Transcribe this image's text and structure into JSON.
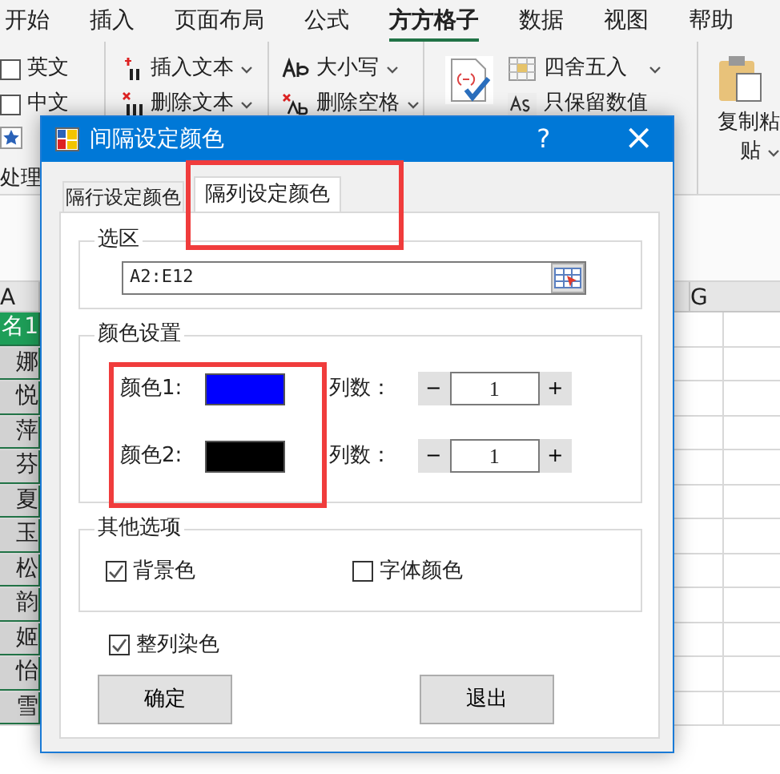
{
  "ribbon_tabs": [
    {
      "label": "开始",
      "selected": false
    },
    {
      "label": "插入",
      "selected": false
    },
    {
      "label": "页面布局",
      "selected": false
    },
    {
      "label": "公式",
      "selected": false
    },
    {
      "label": "方方格子",
      "selected": true
    },
    {
      "label": "数据",
      "selected": false
    },
    {
      "label": "视图",
      "selected": false
    },
    {
      "label": "帮助",
      "selected": false
    }
  ],
  "ribbon": {
    "checkboxes": [
      {
        "label": "英文",
        "checked": false
      },
      {
        "label": "中文",
        "checked": false
      }
    ],
    "group_label": "处理",
    "text_tools": [
      {
        "label": "插入文本",
        "kind": "insert"
      },
      {
        "label": "删除文本",
        "kind": "delete"
      }
    ],
    "case_tools": [
      {
        "label": "大小写",
        "kind": "case"
      },
      {
        "label": "删除空格",
        "kind": "space"
      }
    ],
    "number_tools": [
      {
        "label": "四舍五入",
        "kind": "round"
      },
      {
        "label": "只保留数值",
        "kind": "keep"
      }
    ],
    "paste_label": [
      "复制粘",
      "贴"
    ]
  },
  "sheet": {
    "column_headers": [
      "A",
      "G"
    ],
    "header_cell": "名1",
    "names": [
      "娜",
      "悦",
      "萍",
      "芬",
      "夏",
      "玉",
      "松",
      "韵",
      "姬",
      "怡",
      "雪"
    ]
  },
  "dialog": {
    "title": "间隔设定颜色",
    "help": "?",
    "close": "×",
    "tabs": [
      {
        "label": "隔行设定颜色",
        "selected": false
      },
      {
        "label": "隔列设定颜色",
        "selected": true
      }
    ],
    "range_group": {
      "legend": "选区",
      "value": "A2:E12"
    },
    "color_group": {
      "legend": "颜色设置",
      "rows": [
        {
          "label": "颜色1:",
          "color": "#0000ff",
          "count_label": "列数：",
          "minus": "−",
          "value": "1",
          "plus": "+"
        },
        {
          "label": "颜色2:",
          "color": "#000000",
          "count_label": "列数：",
          "minus": "−",
          "value": "1",
          "plus": "+"
        }
      ]
    },
    "options_group": {
      "legend": "其他选项",
      "checkboxes": [
        {
          "label": "背景色",
          "checked": true
        },
        {
          "label": "字体颜色",
          "checked": false
        }
      ]
    },
    "whole_column": {
      "label": "整列染色",
      "checked": true
    },
    "buttons": [
      "确定",
      "退出"
    ]
  }
}
